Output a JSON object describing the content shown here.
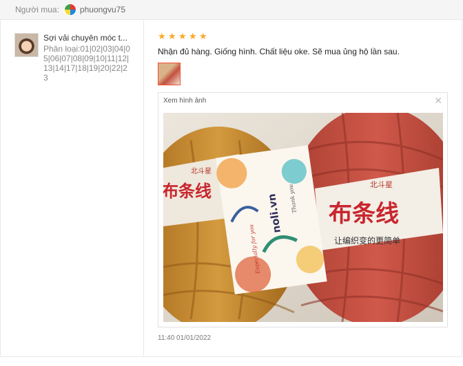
{
  "header": {
    "buyer_label": "Người mua:",
    "buyer_name": "phuongvu75",
    "avatar_icon": "buyer-avatar"
  },
  "product": {
    "title": "Sợi vải chuyên móc t...",
    "variant": "Phân loại:01|02|03|04|05|06|07|08|09|10|11|12|13|14|17|18|19|20|22|23"
  },
  "review": {
    "rating": 5,
    "stars": [
      "★",
      "★",
      "★",
      "★",
      "★"
    ],
    "comment": "Nhận đủ hàng. Giống hình. Chất liệu oke. Sẽ mua ủng hộ lần sau.",
    "viewer_title": "Xem hình ảnh",
    "close_glyph": "✕",
    "timestamp": "11:40 01/01/2022"
  },
  "photo_text": {
    "brand": "noli.vn",
    "tag_left": "北斗星",
    "tag_main": "布条线",
    "tag_sub": "让编织变的更简单",
    "card_script": "Especially for you",
    "card_script2": "Thank you"
  },
  "colors": {
    "star": "#f9a825",
    "accent": "#ee4d2d",
    "yarn_left": "#c98a2c",
    "yarn_right": "#c24f3f"
  }
}
